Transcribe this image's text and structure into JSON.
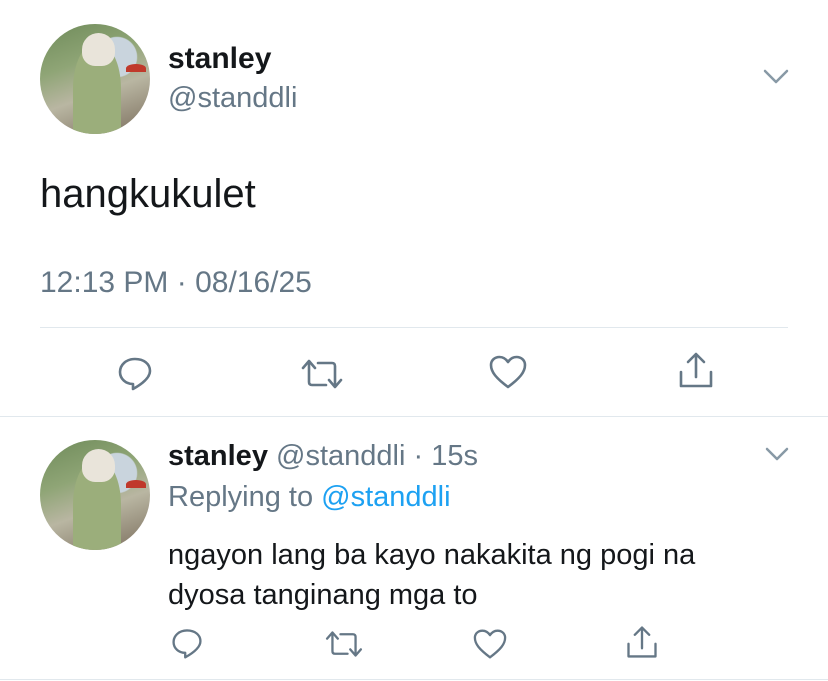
{
  "main_tweet": {
    "display_name": "stanley",
    "handle": "@standdli",
    "text": "hangkukulet",
    "timestamp": "12:13 PM · 08/16/25"
  },
  "reply_tweet": {
    "display_name": "stanley",
    "handle": "@standdli",
    "time_ago": "15s",
    "replying_prefix": "Replying to",
    "replying_handle": "@standdli",
    "text_line1": "ngayon lang ba kayo nakakita ng pogi na",
    "text_line2": "dyosa tanginang mga to"
  },
  "colors": {
    "text": "#14171a",
    "secondary": "#657786",
    "link": "#1da1f2",
    "divider": "#e1e8ed"
  },
  "icons": [
    "chevron-down-icon",
    "reply-icon",
    "retweet-icon",
    "like-icon",
    "share-icon"
  ]
}
